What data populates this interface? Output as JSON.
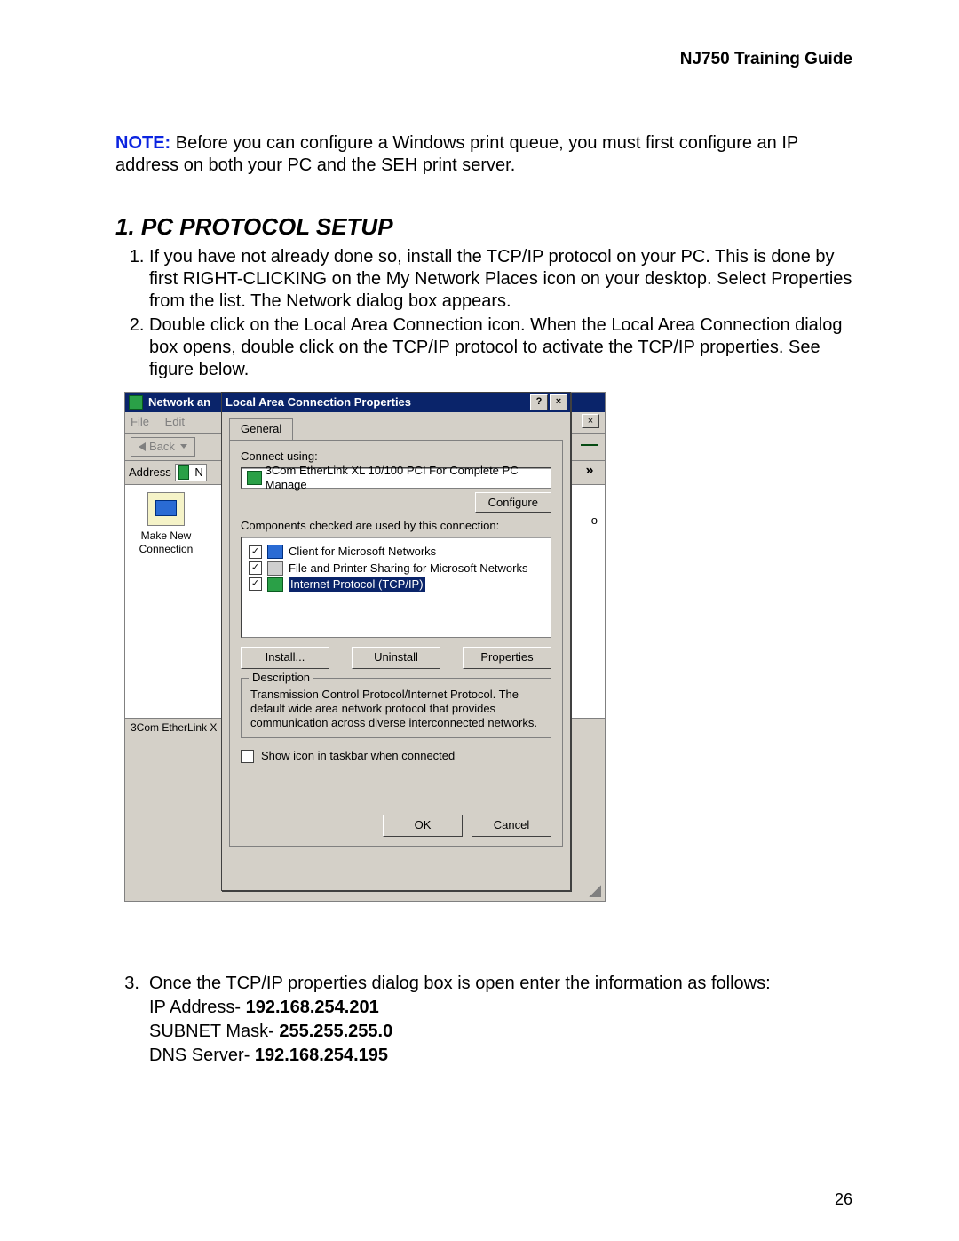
{
  "header": {
    "title": "NJ750 Training Guide"
  },
  "note": {
    "label": "NOTE:",
    "text": "  Before you can configure a Windows print queue, you must first configure an IP address on both your PC and the SEH print server."
  },
  "section": {
    "title": "1. PC PROTOCOL SETUP"
  },
  "steps": {
    "s1": "If you have not already done so, install the TCP/IP protocol on your PC. This is done by first RIGHT-CLICKING on the My Network Places icon on your desktop. Select Properties from the list. The Network dialog box appears.",
    "s2": "Double click on the Local Area Connection icon. When the Local Area Connection dialog box opens, double click on the TCP/IP protocol to activate the TCP/IP properties. See figure below."
  },
  "explorer": {
    "title_prefix": "Network an",
    "menu_file": "File",
    "menu_edit": "Edit",
    "back": "Back",
    "address_label": "Address",
    "addr_letter": "N",
    "item_line1": "Make New",
    "item_line2": "Connection",
    "status": "3Com EtherLink X",
    "right_chevron": "»",
    "right_o": "o"
  },
  "dialog": {
    "title": "Local Area Connection Properties",
    "help_btn": "?",
    "close_btn": "×",
    "tab_general": "General",
    "connect_using": "Connect using:",
    "adapter": "3Com EtherLink XL 10/100 PCI For Complete PC Manage",
    "configure": "Configure",
    "components_label": "Components checked are used by this connection:",
    "components": {
      "c1": "Client for Microsoft Networks",
      "c2": "File and Printer Sharing for Microsoft Networks",
      "c3": "Internet Protocol (TCP/IP)"
    },
    "install": "Install...",
    "uninstall": "Uninstall",
    "properties": "Properties",
    "desc_legend": "Description",
    "desc_text": "Transmission Control Protocol/Internet Protocol. The default wide area network protocol that provides communication across diverse interconnected networks.",
    "taskbar": "Show icon in taskbar when connected",
    "ok": "OK",
    "cancel": "Cancel",
    "check": "✓"
  },
  "step3": {
    "text": "Once the TCP/IP properties dialog box is open enter the information as follows:",
    "ip_label": "IP Address- ",
    "ip_value": "192.168.254.201",
    "subnet_label": "SUBNET Mask- ",
    "subnet_value": "255.255.255.0",
    "dns_label": "DNS Server- ",
    "dns_value": "192.168.254.195"
  },
  "page_number": "26"
}
